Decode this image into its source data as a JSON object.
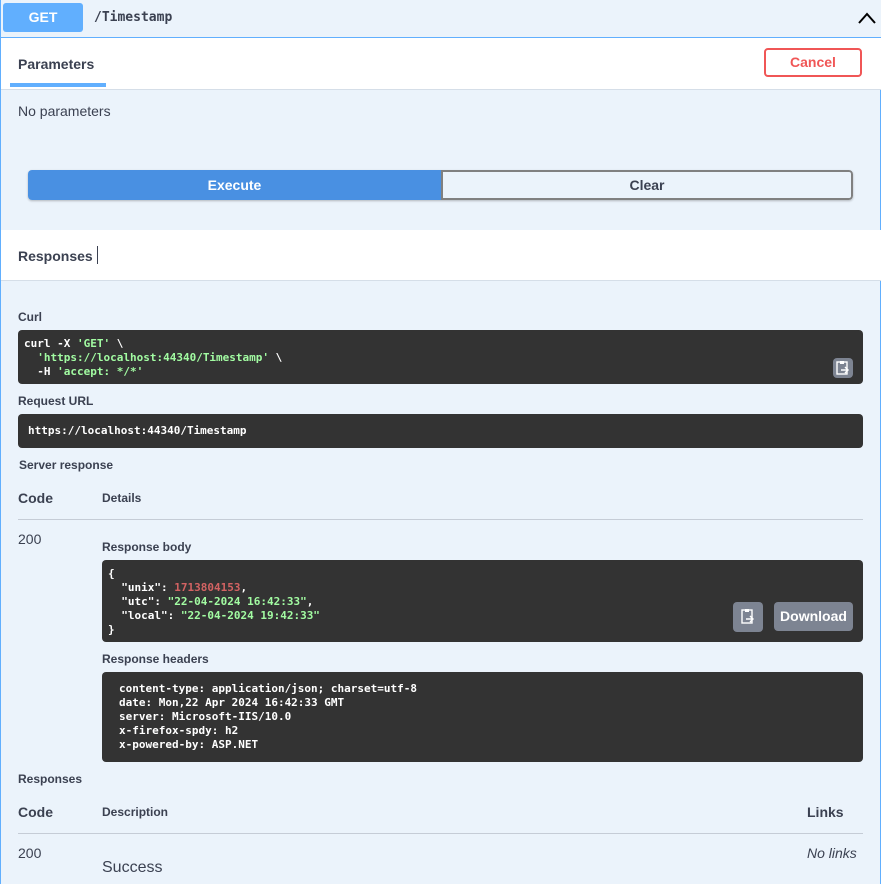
{
  "operation": {
    "method": "GET",
    "path": "/Timestamp"
  },
  "tabs": {
    "parameters": "Parameters",
    "cancel": "Cancel"
  },
  "parameters": {
    "empty_text": "No parameters"
  },
  "actions": {
    "execute": "Execute",
    "clear": "Clear"
  },
  "responses_section": {
    "title": "Responses"
  },
  "curl": {
    "label": "Curl",
    "cmd_prefix": "curl -X ",
    "method_quoted": "'GET'",
    "line1_suffix": " \\",
    "url_quoted": "'https://localhost:44340/Timestamp'",
    "line2_suffix": " \\",
    "header_flag": "-H ",
    "header_quoted": "'accept: */*'"
  },
  "request_url": {
    "label": "Request URL",
    "value": "https://localhost:44340/Timestamp"
  },
  "server_response": {
    "label": "Server response",
    "code_header": "Code",
    "details_header": "Details",
    "code": "200",
    "body_label": "Response body",
    "body": {
      "open": "{",
      "unix_key": "\"unix\"",
      "unix_value": "1713804153",
      "utc_key": "\"utc\"",
      "utc_value": "\"22-04-2024 16:42:33\"",
      "local_key": "\"local\"",
      "local_value": "\"22-04-2024 19:42:33\"",
      "close": "}"
    },
    "download": "Download",
    "headers_label": "Response headers",
    "headers": [
      "content-type: application/json; charset=utf-8",
      "date: Mon,22 Apr 2024 16:42:33 GMT",
      "server: Microsoft-IIS/10.0",
      "x-firefox-spdy: h2",
      "x-powered-by: ASP.NET"
    ]
  },
  "responses_table": {
    "label": "Responses",
    "code_header": "Code",
    "description_header": "Description",
    "links_header": "Links",
    "code": "200",
    "description": "Success",
    "links": "No links"
  },
  "colors": {
    "get_accent": "#61affe",
    "execute": "#4990e2",
    "cancel": "#f05656",
    "code_bg": "#333333",
    "string": "#a2fca2",
    "number": "#d36363"
  }
}
